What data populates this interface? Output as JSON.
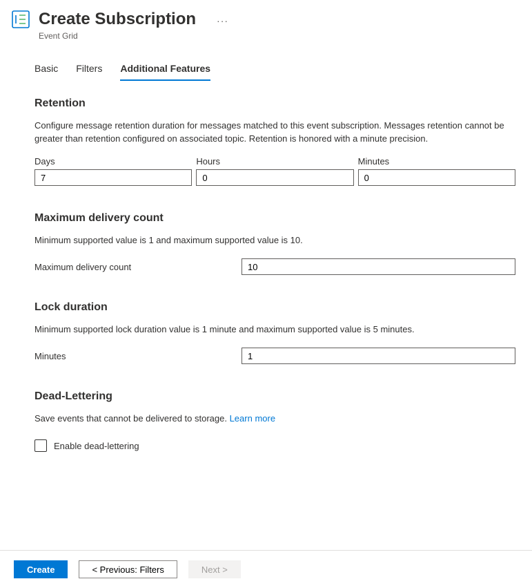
{
  "header": {
    "title": "Create Subscription",
    "subtitle": "Event Grid"
  },
  "tabs": {
    "basic": "Basic",
    "filters": "Filters",
    "additional": "Additional Features"
  },
  "retention": {
    "title": "Retention",
    "description": "Configure message retention duration for messages matched to this event subscription. Messages retention cannot be greater than retention configured on associated topic. Retention is honored with a minute precision.",
    "days_label": "Days",
    "days_value": "7",
    "hours_label": "Hours",
    "hours_value": "0",
    "minutes_label": "Minutes",
    "minutes_value": "0"
  },
  "max_delivery": {
    "title": "Maximum delivery count",
    "description": "Minimum supported value is 1 and maximum supported value is 10.",
    "label": "Maximum delivery count",
    "value": "10"
  },
  "lock_duration": {
    "title": "Lock duration",
    "description": "Minimum supported lock duration value is 1 minute and maximum supported value is 5 minutes.",
    "label": "Minutes",
    "value": "1"
  },
  "dead_lettering": {
    "title": "Dead-Lettering",
    "description": "Save events that cannot be delivered to storage. ",
    "learn_more": "Learn more",
    "checkbox_label": "Enable dead-lettering"
  },
  "footer": {
    "create": "Create",
    "previous": "<  Previous: Filters",
    "next": "Next  >"
  }
}
